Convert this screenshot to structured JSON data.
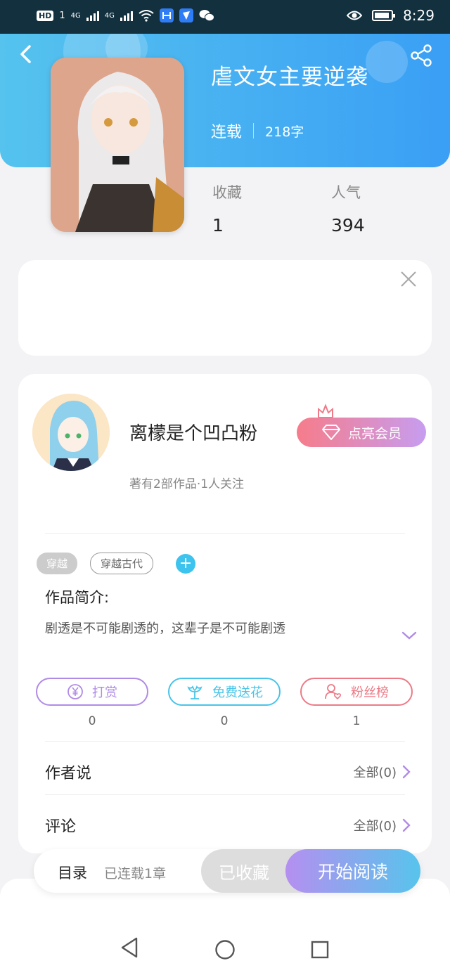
{
  "status_bar": {
    "hd": "HD",
    "sim": "1",
    "net1": "4G",
    "net2": "4G",
    "time": "8:29"
  },
  "book": {
    "title": "虐文女主要逆袭",
    "status": "连载",
    "word_count": "218字",
    "cover_text": "虐文女主要逆袭"
  },
  "stats": {
    "favorites_label": "收藏",
    "favorites_value": "1",
    "popularity_label": "人气",
    "popularity_value": "394"
  },
  "author": {
    "name": "离檬是个凹凸粉",
    "info": "著有2部作品·1人关注",
    "vip_label": "点亮会员"
  },
  "tags": [
    "穿越",
    "穿越古代"
  ],
  "intro": {
    "heading": "作品简介:",
    "text": "剧透是不可能剧透的，这辈子是不可能剧透"
  },
  "actions": [
    {
      "label": "打赏",
      "count": "0",
      "color": "#b08be6"
    },
    {
      "label": "免费送花",
      "count": "0",
      "color": "#48c4e8"
    },
    {
      "label": "粉丝榜",
      "count": "1",
      "color": "#ec7a86"
    }
  ],
  "rows": {
    "author_says": "作者说",
    "author_says_all": "全部(0)",
    "comments": "评论",
    "comments_all": "全部(0)"
  },
  "bottom_bar": {
    "toc": "目录",
    "chapters": "已连载1章",
    "favorited": "已收藏",
    "start_reading": "开始阅读"
  },
  "colors": {
    "header_start": "#55c3ee",
    "header_end": "#3a9ff5",
    "accent_purple": "#b08be6"
  }
}
